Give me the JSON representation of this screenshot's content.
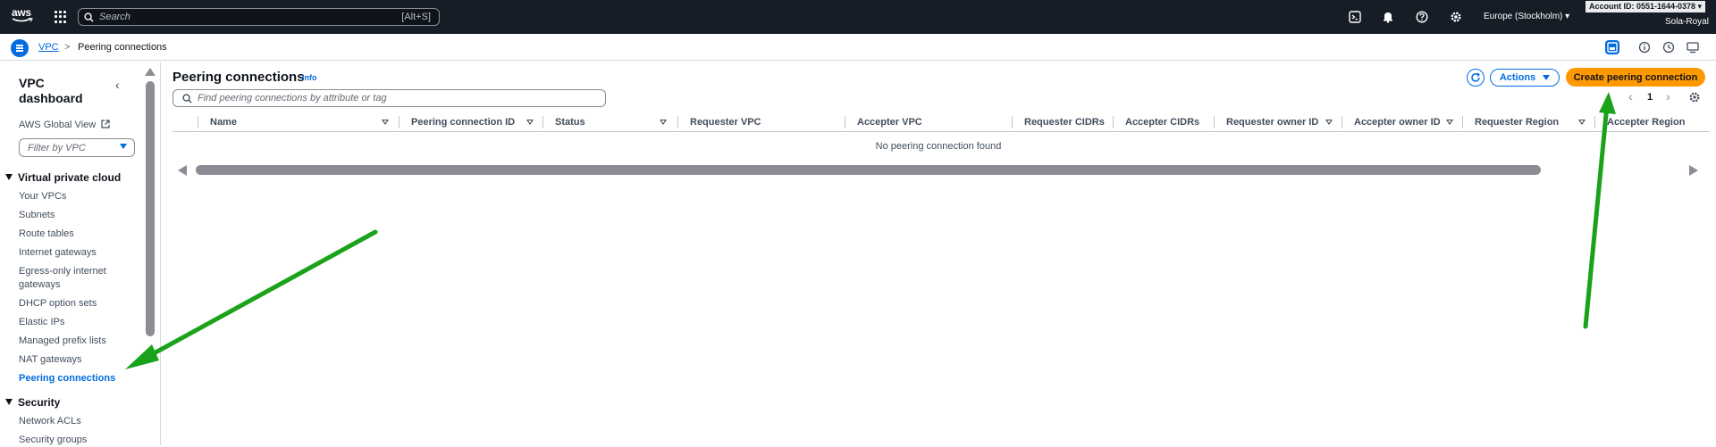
{
  "topnav": {
    "logo_text": "aws",
    "search_placeholder": "Search",
    "search_shortcut": "[Alt+S]",
    "region": "Europe (Stockholm) ▾",
    "account": "Account ID: 0551-1644-0378 ▾",
    "username": "Sola-Royal"
  },
  "breadcrumb": {
    "service": "VPC",
    "separator": ">",
    "current": "Peering connections"
  },
  "sidebar": {
    "title": "VPC dashboard",
    "collapse_glyph": "‹",
    "global_view": "AWS Global View",
    "filter_placeholder": "Filter by VPC",
    "sections": [
      {
        "label": "Virtual private cloud",
        "items": [
          "Your VPCs",
          "Subnets",
          "Route tables",
          "Internet gateways",
          "Egress-only internet gateways",
          "DHCP option sets",
          "Elastic IPs",
          "Managed prefix lists",
          "NAT gateways",
          "Peering connections"
        ]
      },
      {
        "label": "Security",
        "items": [
          "Network ACLs",
          "Security groups"
        ]
      }
    ],
    "active_item": "Peering connections"
  },
  "main": {
    "title": "Peering connections",
    "info": "Info",
    "search_placeholder": "Find peering connections by attribute or tag",
    "actions_label": "Actions",
    "create_label": "Create peering connection",
    "page_number": "1",
    "prev_glyph": "‹",
    "next_glyph": "›",
    "columns": [
      "Name",
      "Peering connection ID",
      "Status",
      "Requester VPC",
      "Accepter VPC",
      "Requester CIDRs",
      "Accepter CIDRs",
      "Requester owner ID",
      "Accepter owner ID",
      "Requester Region",
      "Accepter Region"
    ],
    "empty_message": "No peering connection found"
  },
  "colors": {
    "nav_bg": "#161d26",
    "link_blue": "#006ce0",
    "primary_orange": "#ff9900",
    "annotation_green": "#1aa31a"
  }
}
